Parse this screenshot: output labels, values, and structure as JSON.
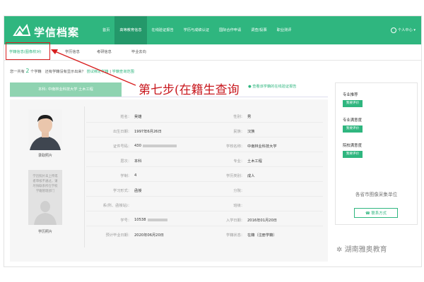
{
  "header": {
    "brand": "学信档案",
    "nav": [
      "首页",
      "高等教育信息",
      "在线验证报告",
      "学历与成绩认证",
      "国际合作申请",
      "调查/投票",
      "职业测评"
    ],
    "active_nav_index": 1,
    "user": "个人中心"
  },
  "subnav": {
    "tabs": [
      "学籍信息(图像校对)",
      "学历信息",
      "考研信息",
      "毕业去向"
    ],
    "active_index": 0
  },
  "summary": {
    "prefix": "您一共有",
    "count": "2",
    "unit": "个学籍",
    "question": "还有学籍没有显示出来？",
    "link1": "尝试绑定学籍",
    "sep": "|",
    "link2": "学籍查询范围"
  },
  "school_bar": "本科: 中南林业科技大学 土木工程",
  "annotation": "第七步(在籍生查询",
  "verify_link": "查看该学籍的在线验证报告",
  "fields": {
    "name_label": "姓名：",
    "name_value": "吴雄",
    "gender_label": "性别：",
    "gender_value": "男",
    "birth_label": "出生日期：",
    "birth_value": "1997年6月26日",
    "ethnic_label": "民族：",
    "ethnic_value": "汉族",
    "id_label": "证件号码：",
    "id_value": "430",
    "school_label": "学校名称：",
    "school_value": "中南林业科技大学",
    "level_label": "层次：",
    "level_value": "本科",
    "major_label": "专业：",
    "major_value": "土木工程",
    "years_label": "学制：",
    "years_value": "4",
    "type_label": "学历类别：",
    "type_value": "成人",
    "form_label": "学习形式：",
    "form_value": "函授",
    "branch_label": "分院：",
    "dept_label": "系(所、函授站)：",
    "class_label": "班级：",
    "sid_label": "学号：",
    "sid_value": "10538",
    "enroll_label": "入学日期：",
    "enroll_value": "2016年01月20日",
    "grad_label": "预计毕业日期：",
    "grad_value": "2020年06月20日",
    "status_label": "学籍状态：",
    "status_value": "在籍（注册学籍）"
  },
  "photos": {
    "photo1_caption": "录取照片",
    "photo2_caption": "学历照片",
    "photo2_placeholder": "学历照片未上传或者审核不通过，请尽快联系所在学校学籍管理部门"
  },
  "sidebar": {
    "items": [
      {
        "title": "专业推荐",
        "button": "我要评价"
      },
      {
        "title": "专业满意度",
        "button": "我要评价"
      },
      {
        "title": "院校满意度",
        "button": "我要评价"
      }
    ],
    "footer": "各省市图像采集单位",
    "contact": "联系方式"
  },
  "watermark": "湖南雅奥教育",
  "colors": {
    "brand_green": "#2fb67f",
    "annotation_red": "#c8171d"
  }
}
